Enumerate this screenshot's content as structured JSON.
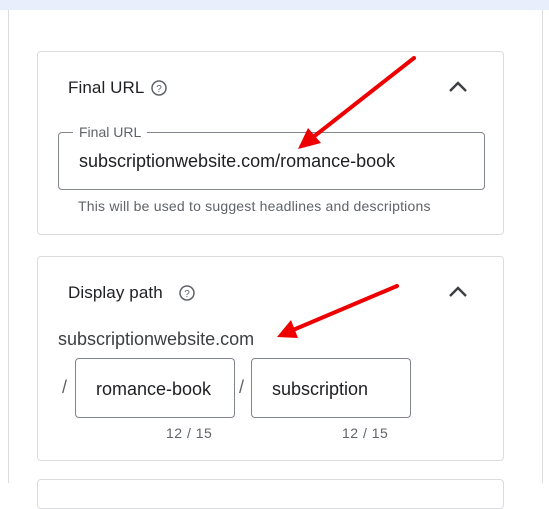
{
  "final_url": {
    "title": "Final URL",
    "field_label": "Final URL",
    "value": "subscriptionwebsite.com/romance-book",
    "helper": "This will be used to suggest headlines and descriptions"
  },
  "display_path": {
    "title": "Display path",
    "domain": "subscriptionwebsite.com",
    "separator": "/",
    "path1": {
      "value": "romance-book",
      "counter": "12 / 15"
    },
    "path2": {
      "value": "subscription",
      "counter": "12 / 15"
    }
  },
  "icons": {
    "help": "help-circle-icon",
    "collapse": "chevron-up-icon",
    "annotation": "red-arrow"
  },
  "colors": {
    "border": "#dadce0",
    "field_border": "#80868b",
    "text": "#202124",
    "muted": "#5f6368",
    "annotation": "#ee0000",
    "top_band": "#e8eefc"
  }
}
